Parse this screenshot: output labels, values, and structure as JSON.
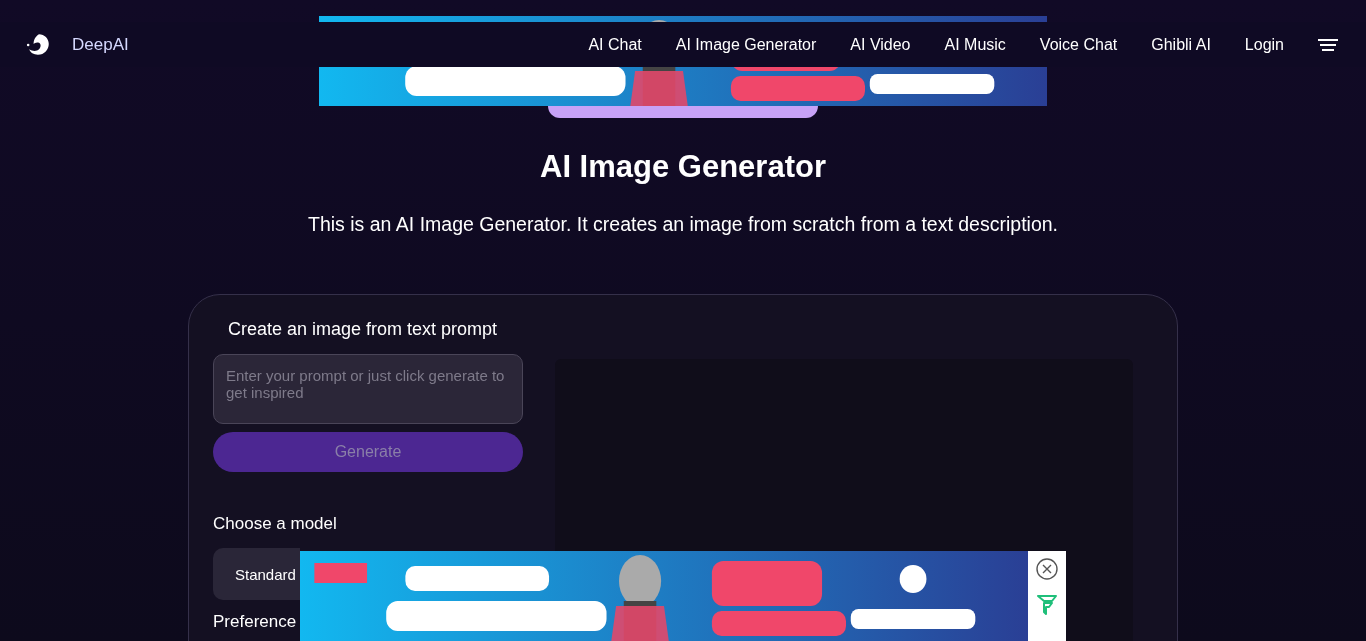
{
  "brand": {
    "name": "DeepAI"
  },
  "nav": [
    {
      "label": "AI Chat"
    },
    {
      "label": "AI Image Generator"
    },
    {
      "label": "AI Video"
    },
    {
      "label": "AI Music"
    },
    {
      "label": "Voice Chat"
    },
    {
      "label": "Ghibli AI"
    },
    {
      "label": "Login"
    }
  ],
  "page": {
    "title": "AI Image Generator",
    "description": "This is an AI Image Generator. It creates an image from scratch from a text description."
  },
  "form": {
    "heading": "Create an image from text prompt",
    "prompt": {
      "placeholder": "Enter your prompt or just click generate to get inspired"
    },
    "generate_button": {
      "label": "Generate",
      "disabled": true
    },
    "model_label": "Choose a model",
    "model_value": "Standard",
    "preferences_label": "Preference"
  }
}
